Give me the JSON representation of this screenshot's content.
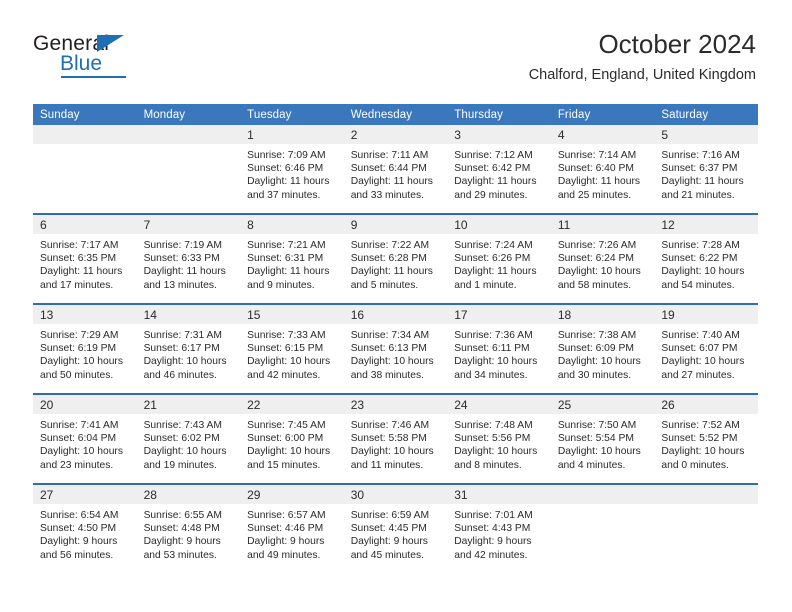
{
  "brand": {
    "name_top": "General",
    "name_bottom": "Blue",
    "accent_color": "#1f6fb5"
  },
  "header": {
    "title": "October 2024",
    "subtitle": "Chalford, England, United Kingdom"
  },
  "theme": {
    "header_blue": "#3a77bd",
    "separator_blue": "#2f6cb2",
    "daynum_band": "#efefef",
    "text": "#2b2b2b"
  },
  "weekdays": [
    "Sunday",
    "Monday",
    "Tuesday",
    "Wednesday",
    "Thursday",
    "Friday",
    "Saturday"
  ],
  "labels": {
    "sunrise_prefix": "Sunrise:",
    "sunset_prefix": "Sunset:",
    "daylight_prefix": "Daylight:"
  },
  "weeks": [
    {
      "days": [
        {
          "day": "",
          "sunrise": "",
          "sunset": "",
          "daylight": "",
          "empty": true
        },
        {
          "day": "",
          "sunrise": "",
          "sunset": "",
          "daylight": "",
          "empty": true
        },
        {
          "day": "1",
          "sunrise": "Sunrise: 7:09 AM",
          "sunset": "Sunset: 6:46 PM",
          "daylight": "Daylight: 11 hours and 37 minutes."
        },
        {
          "day": "2",
          "sunrise": "Sunrise: 7:11 AM",
          "sunset": "Sunset: 6:44 PM",
          "daylight": "Daylight: 11 hours and 33 minutes."
        },
        {
          "day": "3",
          "sunrise": "Sunrise: 7:12 AM",
          "sunset": "Sunset: 6:42 PM",
          "daylight": "Daylight: 11 hours and 29 minutes."
        },
        {
          "day": "4",
          "sunrise": "Sunrise: 7:14 AM",
          "sunset": "Sunset: 6:40 PM",
          "daylight": "Daylight: 11 hours and 25 minutes."
        },
        {
          "day": "5",
          "sunrise": "Sunrise: 7:16 AM",
          "sunset": "Sunset: 6:37 PM",
          "daylight": "Daylight: 11 hours and 21 minutes."
        }
      ]
    },
    {
      "days": [
        {
          "day": "6",
          "sunrise": "Sunrise: 7:17 AM",
          "sunset": "Sunset: 6:35 PM",
          "daylight": "Daylight: 11 hours and 17 minutes."
        },
        {
          "day": "7",
          "sunrise": "Sunrise: 7:19 AM",
          "sunset": "Sunset: 6:33 PM",
          "daylight": "Daylight: 11 hours and 13 minutes."
        },
        {
          "day": "8",
          "sunrise": "Sunrise: 7:21 AM",
          "sunset": "Sunset: 6:31 PM",
          "daylight": "Daylight: 11 hours and 9 minutes."
        },
        {
          "day": "9",
          "sunrise": "Sunrise: 7:22 AM",
          "sunset": "Sunset: 6:28 PM",
          "daylight": "Daylight: 11 hours and 5 minutes."
        },
        {
          "day": "10",
          "sunrise": "Sunrise: 7:24 AM",
          "sunset": "Sunset: 6:26 PM",
          "daylight": "Daylight: 11 hours and 1 minute."
        },
        {
          "day": "11",
          "sunrise": "Sunrise: 7:26 AM",
          "sunset": "Sunset: 6:24 PM",
          "daylight": "Daylight: 10 hours and 58 minutes."
        },
        {
          "day": "12",
          "sunrise": "Sunrise: 7:28 AM",
          "sunset": "Sunset: 6:22 PM",
          "daylight": "Daylight: 10 hours and 54 minutes."
        }
      ]
    },
    {
      "days": [
        {
          "day": "13",
          "sunrise": "Sunrise: 7:29 AM",
          "sunset": "Sunset: 6:19 PM",
          "daylight": "Daylight: 10 hours and 50 minutes."
        },
        {
          "day": "14",
          "sunrise": "Sunrise: 7:31 AM",
          "sunset": "Sunset: 6:17 PM",
          "daylight": "Daylight: 10 hours and 46 minutes."
        },
        {
          "day": "15",
          "sunrise": "Sunrise: 7:33 AM",
          "sunset": "Sunset: 6:15 PM",
          "daylight": "Daylight: 10 hours and 42 minutes."
        },
        {
          "day": "16",
          "sunrise": "Sunrise: 7:34 AM",
          "sunset": "Sunset: 6:13 PM",
          "daylight": "Daylight: 10 hours and 38 minutes."
        },
        {
          "day": "17",
          "sunrise": "Sunrise: 7:36 AM",
          "sunset": "Sunset: 6:11 PM",
          "daylight": "Daylight: 10 hours and 34 minutes."
        },
        {
          "day": "18",
          "sunrise": "Sunrise: 7:38 AM",
          "sunset": "Sunset: 6:09 PM",
          "daylight": "Daylight: 10 hours and 30 minutes."
        },
        {
          "day": "19",
          "sunrise": "Sunrise: 7:40 AM",
          "sunset": "Sunset: 6:07 PM",
          "daylight": "Daylight: 10 hours and 27 minutes."
        }
      ]
    },
    {
      "days": [
        {
          "day": "20",
          "sunrise": "Sunrise: 7:41 AM",
          "sunset": "Sunset: 6:04 PM",
          "daylight": "Daylight: 10 hours and 23 minutes."
        },
        {
          "day": "21",
          "sunrise": "Sunrise: 7:43 AM",
          "sunset": "Sunset: 6:02 PM",
          "daylight": "Daylight: 10 hours and 19 minutes."
        },
        {
          "day": "22",
          "sunrise": "Sunrise: 7:45 AM",
          "sunset": "Sunset: 6:00 PM",
          "daylight": "Daylight: 10 hours and 15 minutes."
        },
        {
          "day": "23",
          "sunrise": "Sunrise: 7:46 AM",
          "sunset": "Sunset: 5:58 PM",
          "daylight": "Daylight: 10 hours and 11 minutes."
        },
        {
          "day": "24",
          "sunrise": "Sunrise: 7:48 AM",
          "sunset": "Sunset: 5:56 PM",
          "daylight": "Daylight: 10 hours and 8 minutes."
        },
        {
          "day": "25",
          "sunrise": "Sunrise: 7:50 AM",
          "sunset": "Sunset: 5:54 PM",
          "daylight": "Daylight: 10 hours and 4 minutes."
        },
        {
          "day": "26",
          "sunrise": "Sunrise: 7:52 AM",
          "sunset": "Sunset: 5:52 PM",
          "daylight": "Daylight: 10 hours and 0 minutes."
        }
      ]
    },
    {
      "days": [
        {
          "day": "27",
          "sunrise": "Sunrise: 6:54 AM",
          "sunset": "Sunset: 4:50 PM",
          "daylight": "Daylight: 9 hours and 56 minutes."
        },
        {
          "day": "28",
          "sunrise": "Sunrise: 6:55 AM",
          "sunset": "Sunset: 4:48 PM",
          "daylight": "Daylight: 9 hours and 53 minutes."
        },
        {
          "day": "29",
          "sunrise": "Sunrise: 6:57 AM",
          "sunset": "Sunset: 4:46 PM",
          "daylight": "Daylight: 9 hours and 49 minutes."
        },
        {
          "day": "30",
          "sunrise": "Sunrise: 6:59 AM",
          "sunset": "Sunset: 4:45 PM",
          "daylight": "Daylight: 9 hours and 45 minutes."
        },
        {
          "day": "31",
          "sunrise": "Sunrise: 7:01 AM",
          "sunset": "Sunset: 4:43 PM",
          "daylight": "Daylight: 9 hours and 42 minutes."
        },
        {
          "day": "",
          "sunrise": "",
          "sunset": "",
          "daylight": "",
          "empty": true
        },
        {
          "day": "",
          "sunrise": "",
          "sunset": "",
          "daylight": "",
          "empty": true
        }
      ]
    }
  ]
}
